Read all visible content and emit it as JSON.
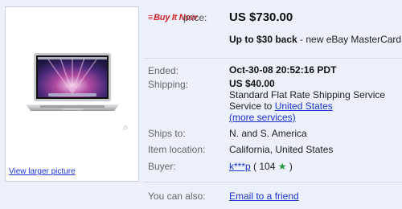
{
  "image": {
    "view_larger": "View larger picture"
  },
  "buy_it_now": {
    "logo_text": "Buy It Now",
    "price_label": "price:",
    "price_value": "US $730.00"
  },
  "promo": {
    "bold": "Up to $30 back",
    "rest": " - new eBay MasterCard"
  },
  "details": {
    "ended": {
      "label": "Ended:",
      "value": "Oct-30-08 20:52:16 PDT"
    },
    "shipping": {
      "label": "Shipping:",
      "cost": "US $40.00",
      "method": "Standard Flat Rate Shipping Service",
      "service_to_prefix": "Service to ",
      "service_to_link": "United States",
      "more_services": "(more services)"
    },
    "ships_to": {
      "label": "Ships to:",
      "value": "N. and S. America"
    },
    "item_location": {
      "label": "Item location:",
      "value": "California, United States"
    },
    "buyer": {
      "label": "Buyer:",
      "name": "k***p",
      "feedback_open": " ( 104 ",
      "feedback_close": " )"
    }
  },
  "you_can_also": {
    "label": "You can also:",
    "link": "Email to a friend"
  }
}
